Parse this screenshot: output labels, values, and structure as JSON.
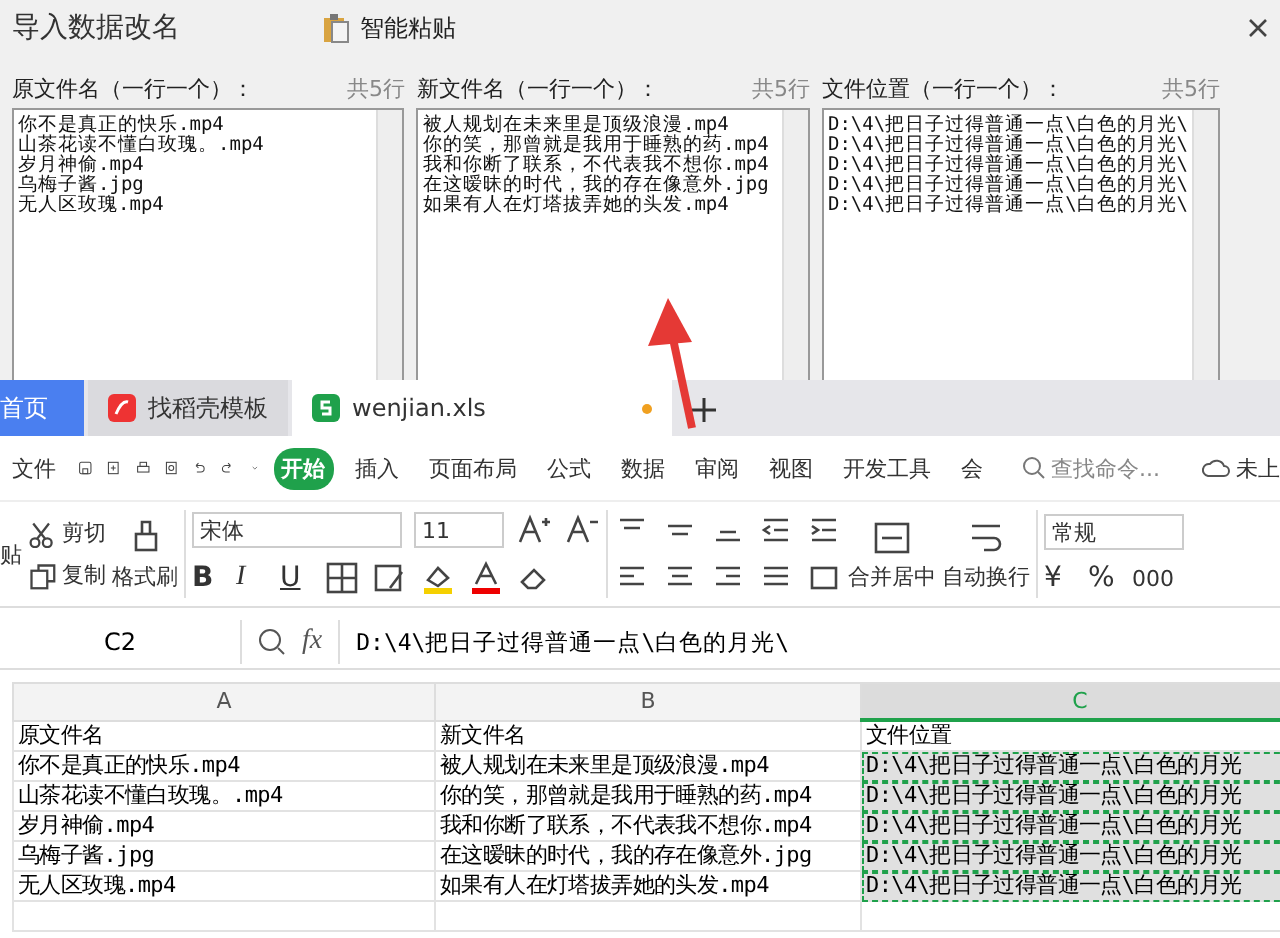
{
  "dialog": {
    "title": "导入数据改名",
    "paste_button": "智能粘贴",
    "panels": [
      {
        "label": "原文件名（一行一个）：",
        "count": "共5行",
        "lines": [
          "你不是真正的快乐.mp4",
          "山茶花读不懂白玫瑰。.mp4",
          "岁月神偷.mp4",
          "乌梅子酱.jpg",
          "无人区玫瑰.mp4"
        ]
      },
      {
        "label": "新文件名（一行一个）：",
        "count": "共5行",
        "lines": [
          "被人规划在未来里是顶级浪漫.mp4",
          "你的笑，那曾就是我用于睡熟的药.mp4",
          "我和你断了联系，不代表我不想你.mp4",
          "在这暧昧的时代，我的存在像意外.jpg",
          "如果有人在灯塔拔弄她的头发.mp4"
        ]
      },
      {
        "label": "文件位置（一行一个）：",
        "count": "共5行",
        "lines": [
          "D:\\4\\把日子过得普通一点\\白色的月光\\",
          "D:\\4\\把日子过得普通一点\\白色的月光\\",
          "D:\\4\\把日子过得普通一点\\白色的月光\\",
          "D:\\4\\把日子过得普通一点\\白色的月光\\",
          "D:\\4\\把日子过得普通一点\\白色的月光\\"
        ]
      }
    ]
  },
  "tabs": [
    {
      "kind": "home",
      "label": "首页",
      "selected": false
    },
    {
      "kind": "template",
      "label": "找稻壳模板",
      "selected": false
    },
    {
      "kind": "sheet",
      "label": "wenjian.xls",
      "selected": true
    }
  ],
  "menu": {
    "file": "文件",
    "items": [
      {
        "label": "开始",
        "selected": true
      },
      {
        "label": "插入",
        "selected": false
      },
      {
        "label": "页面布局",
        "selected": false
      },
      {
        "label": "公式",
        "selected": false
      },
      {
        "label": "数据",
        "selected": false
      },
      {
        "label": "审阅",
        "selected": false
      },
      {
        "label": "视图",
        "selected": false
      },
      {
        "label": "开发工具",
        "selected": false
      },
      {
        "label": "会",
        "selected": false
      }
    ],
    "search_placeholder": "查找命令...",
    "cloud": "未上"
  },
  "ribbon": {
    "paste": "贴",
    "cut": "剪切",
    "copy": "复制",
    "format_painter": "格式刷",
    "font": "宋体",
    "size": "11",
    "format_buttons": [
      "B",
      "I",
      "U"
    ],
    "merge": "合并居中",
    "wrap": "自动换行",
    "number_format": "常规",
    "currency": "¥",
    "percent": "%",
    "thousands": "000"
  },
  "formula_bar": {
    "cell": "C2",
    "fx": "fx",
    "value": "D:\\4\\把日子过得普通一点\\白色的月光\\"
  },
  "sheet": {
    "columns": [
      {
        "label": "A",
        "selected": false
      },
      {
        "label": "B",
        "selected": false
      },
      {
        "label": "C",
        "selected": true
      }
    ],
    "rows": [
      [
        "原文件名",
        "新文件名",
        "文件位置"
      ],
      [
        "你不是真正的快乐.mp4",
        "被人规划在未来里是顶级浪漫.mp4",
        "D:\\4\\把日子过得普通一点\\白色的月光"
      ],
      [
        "山茶花读不懂白玫瑰。.mp4",
        "你的笑，那曾就是我用于睡熟的药.mp4",
        "D:\\4\\把日子过得普通一点\\白色的月光"
      ],
      [
        "岁月神偷.mp4",
        "我和你断了联系，不代表我不想你.mp4",
        "D:\\4\\把日子过得普通一点\\白色的月光"
      ],
      [
        "乌梅子酱.jpg",
        "在这暧昧的时代，我的存在像意外.jpg",
        "D:\\4\\把日子过得普通一点\\白色的月光"
      ],
      [
        "无人区玫瑰.mp4",
        "如果有人在灯塔拔弄她的头发.mp4",
        "D:\\4\\把日子过得普通一点\\白色的月光"
      ]
    ]
  }
}
